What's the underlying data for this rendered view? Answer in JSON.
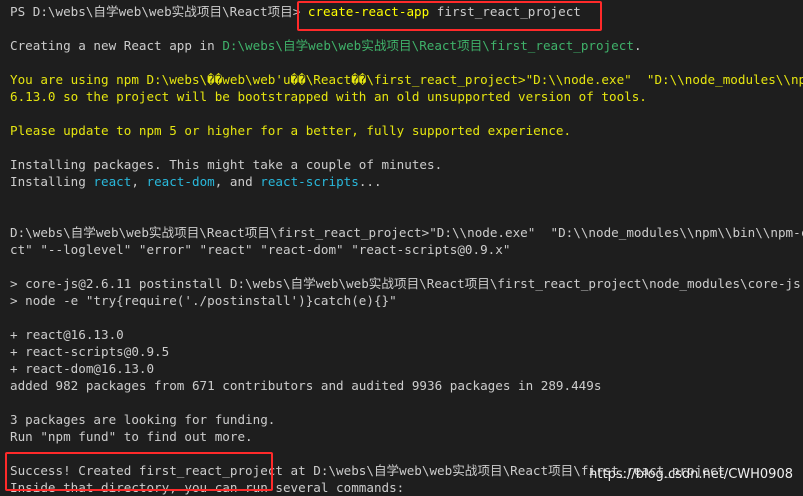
{
  "terminal": {
    "prompt": "PS D:\\webs\\自学web\\web实战项目\\React项目> ",
    "command_name": "create-react-app",
    "command_arg": " first_react_project",
    "creating_prefix": "Creating a new React app in ",
    "creating_path": "D:\\webs\\自学web\\web实战项目\\React项目\\first_react_project",
    "creating_suffix": ".",
    "npm_warn_1": "You are using npm D:\\webs\\��web\\web'u��\\React��\\first_react_project>\"D:\\\\node.exe\"  \"D:\\\\node_modules\\\\npm\\\\bin\\\\",
    "npm_warn_2": "6.13.0 so the project will be bootstrapped with an old unsupported version of tools.",
    "npm_update": "Please update to npm 5 or higher for a better, fully supported experience.",
    "installing_1": "Installing packages. This might take a couple of minutes.",
    "installing_2_prefix": "Installing ",
    "pkg_react": "react",
    "sep_1": ", ",
    "pkg_react_dom": "react-dom",
    "sep_2": ", and ",
    "pkg_react_scripts": "react-scripts",
    "installing_2_suffix": "...",
    "node_cmd_1": "D:\\webs\\自学web\\web实战项目\\React项目\\first_react_project>\"D:\\\\node.exe\"  \"D:\\\\node_modules\\\\npm\\\\bin\\\\npm-cli.js\" \"i",
    "node_cmd_2": "ct\" \"--loglevel\" \"error\" \"react\" \"react-dom\" \"react-scripts@0.9.x\"",
    "postinstall_1": "> core-js@2.6.11 postinstall D:\\webs\\自学web\\web实战项目\\React项目\\first_react_project\\node_modules\\core-js",
    "postinstall_2": "> node -e \"try{require('./postinstall')}catch(e){}\"",
    "added_1": "+ react@16.13.0",
    "added_2": "+ react-scripts@0.9.5",
    "added_3": "+ react-dom@16.13.0",
    "added_summary": "added 982 packages from 671 contributors and audited 9936 packages in 289.449s",
    "funding_1": "3 packages are looking for funding.",
    "funding_2": "Run \"npm fund\" to find out more.",
    "success_highlight": "Success! Created first_react_project",
    "success_rest": " at D:\\webs\\自学web\\web实战项目\\React项目\\first_react_project",
    "inside": "Inside that directory, you can run several commands:"
  },
  "watermark": "https://blog.csdn.net/CWH0908",
  "colors": {
    "background": "#1e1e1e",
    "text": "#cccccc",
    "warning_yellow": "#e5e510",
    "path_green": "#3fb26a",
    "package_cyan": "#29b8db",
    "command_yellow": "#ffff00",
    "highlight_red": "#ff2a2a"
  }
}
